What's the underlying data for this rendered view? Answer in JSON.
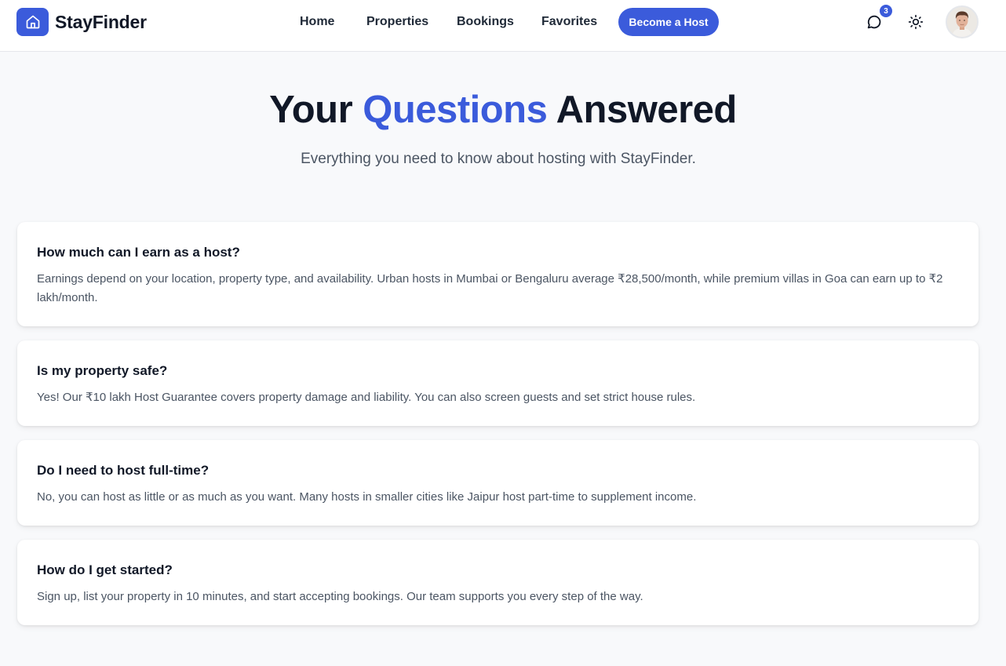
{
  "brand": {
    "name": "StayFinder",
    "logo_icon": "home-icon",
    "accent": "#3b5bdb"
  },
  "nav": {
    "links": [
      "Home",
      "Properties",
      "Bookings",
      "Favorites"
    ],
    "cta_label": "Become a Host"
  },
  "header_actions": {
    "messages_icon": "chat-bubble-icon",
    "messages_count": "3",
    "theme_icon": "sun-icon",
    "avatar_icon": "user-avatar"
  },
  "hero": {
    "title_before": "Your",
    "title_accent": "Questions",
    "title_after": "Answered",
    "subtitle": "Everything you need to know about hosting with StayFinder."
  },
  "faqs": [
    {
      "question": "How much can I earn as a host?",
      "answer": "Earnings depend on your location, property type, and availability. Urban hosts in Mumbai or Bengaluru average ₹28,500/month, while premium villas in Goa can earn up to ₹2 lakh/month."
    },
    {
      "question": "Is my property safe?",
      "answer": "Yes! Our ₹10 lakh Host Guarantee covers property damage and liability. You can also screen guests and set strict house rules."
    },
    {
      "question": "Do I need to host full-time?",
      "answer": "No, you can host as little or as much as you want. Many hosts in smaller cities like Jaipur host part-time to supplement income."
    },
    {
      "question": "How do I get started?",
      "answer": "Sign up, list your property in 10 minutes, and start accepting bookings. Our team supports you every step of the way."
    }
  ]
}
